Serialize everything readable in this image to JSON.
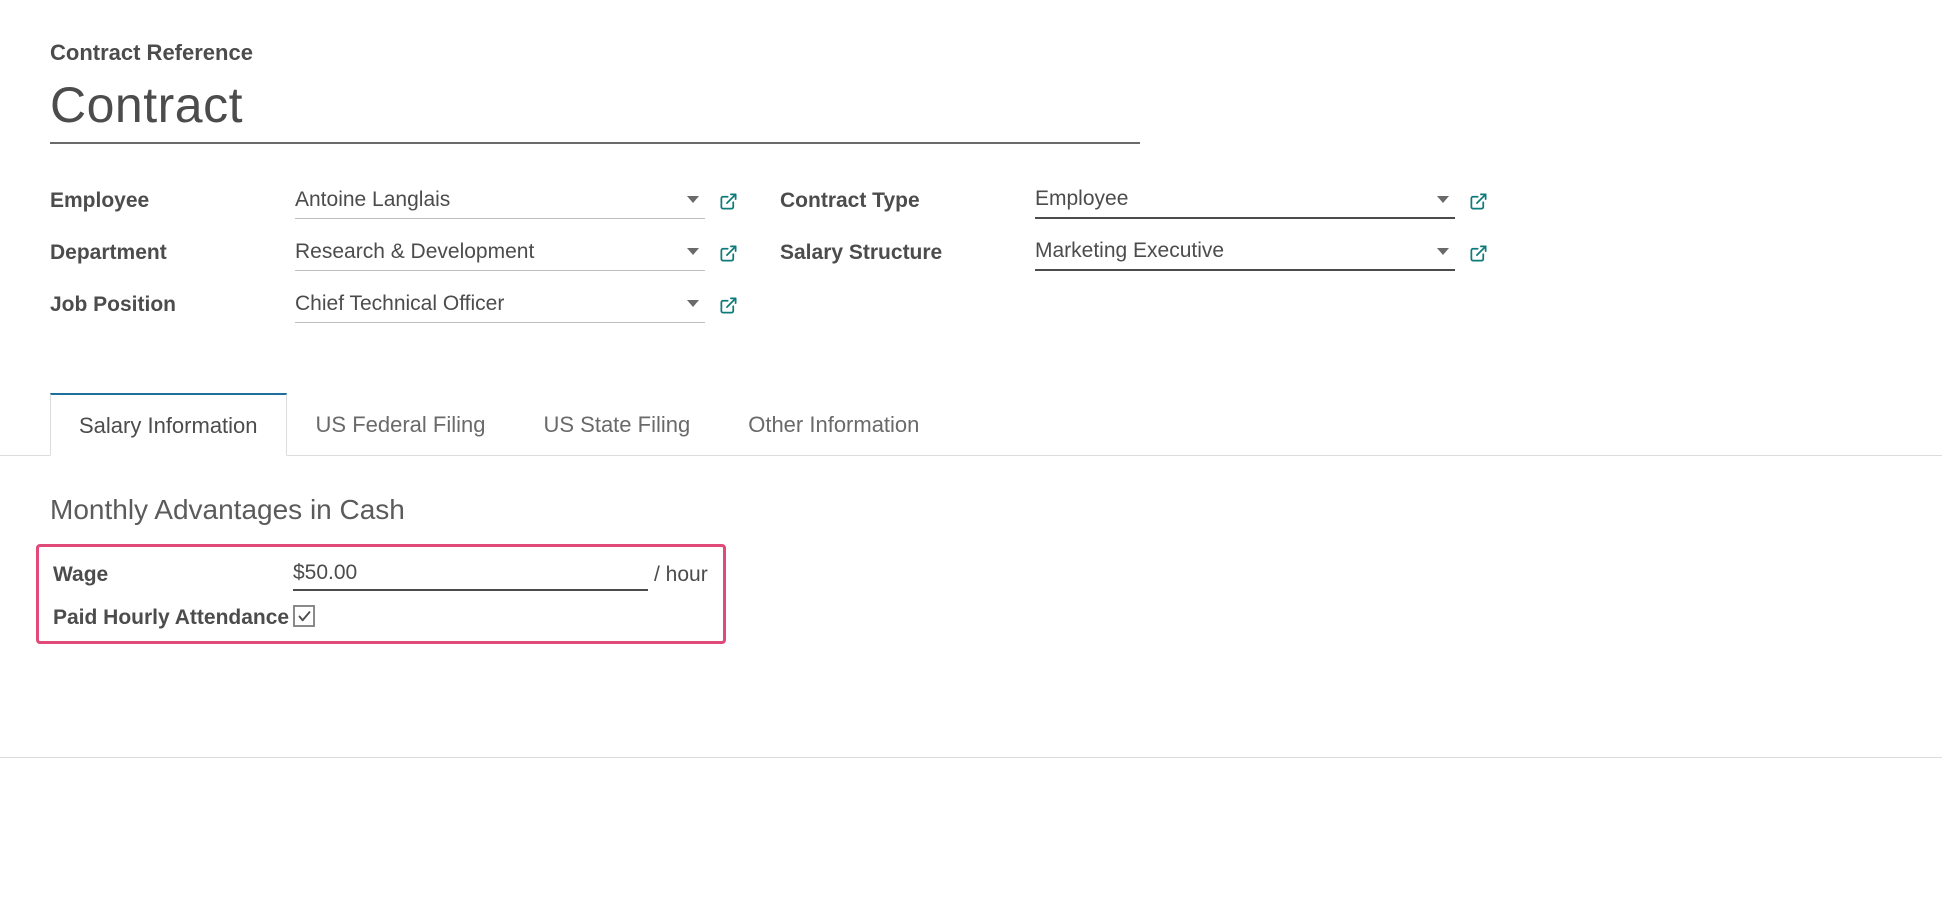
{
  "header": {
    "reference_label": "Contract Reference",
    "title": "Contract"
  },
  "fields_left": [
    {
      "label": "Employee",
      "value": "Antoine Langlais",
      "has_external": true,
      "emph": false
    },
    {
      "label": "Department",
      "value": "Research & Development",
      "has_external": true,
      "emph": false
    },
    {
      "label": "Job Position",
      "value": "Chief Technical Officer",
      "has_external": true,
      "emph": false
    }
  ],
  "fields_right": [
    {
      "label": "Contract Type",
      "value": "Employee",
      "has_external": true,
      "emph": true
    },
    {
      "label": "Salary Structure",
      "value": "Marketing Executive",
      "has_external": true,
      "emph": true
    }
  ],
  "tabs": [
    {
      "label": "Salary Information",
      "active": true
    },
    {
      "label": "US Federal Filing",
      "active": false
    },
    {
      "label": "US State Filing",
      "active": false
    },
    {
      "label": "Other Information",
      "active": false
    }
  ],
  "salary": {
    "section_title": "Monthly Advantages in Cash",
    "wage_label": "Wage",
    "wage_value": "$50.00",
    "wage_suffix": "/ hour",
    "paid_hourly_label": "Paid Hourly Attendance",
    "paid_hourly_checked": true
  }
}
